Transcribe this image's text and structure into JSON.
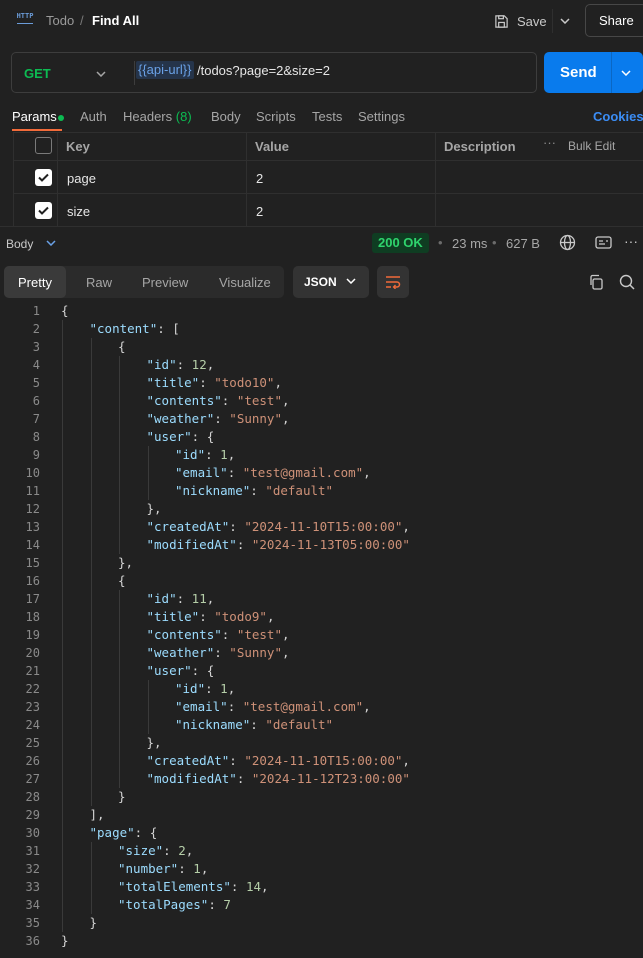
{
  "header": {
    "breadcrumb_parent": "Todo",
    "breadcrumb_sep": "/",
    "title": "Find All",
    "save_label": "Save",
    "share_label": "Share"
  },
  "request": {
    "method": "GET",
    "url_variable": "{{api-url}}",
    "url_path": "/todos?page=2&size=2",
    "send_label": "Send"
  },
  "tabs": {
    "params": "Params",
    "auth": "Auth",
    "headers": "Headers",
    "headers_count": "(8)",
    "body": "Body",
    "scripts": "Scripts",
    "tests": "Tests",
    "settings": "Settings",
    "cookies": "Cookies"
  },
  "params_table": {
    "headers": [
      "Key",
      "Value",
      "Description"
    ],
    "bulk_edit": "Bulk Edit",
    "rows": [
      {
        "key": "page",
        "value": "2",
        "checked": true
      },
      {
        "key": "size",
        "value": "2",
        "checked": true
      }
    ]
  },
  "response": {
    "section_label": "Body",
    "status": "200 OK",
    "time": "23 ms",
    "size": "627 B",
    "view_tabs": [
      "Pretty",
      "Raw",
      "Preview",
      "Visualize"
    ],
    "active_view": "Pretty",
    "format": "JSON"
  },
  "code_lines": [
    {
      "n": "1",
      "indent": 0,
      "parts": [
        [
          "p",
          "{"
        ]
      ]
    },
    {
      "n": "2",
      "indent": 1,
      "parts": [
        [
          "k",
          "\"content\""
        ],
        [
          "p",
          ": ["
        ]
      ]
    },
    {
      "n": "3",
      "indent": 2,
      "parts": [
        [
          "p",
          "{"
        ]
      ]
    },
    {
      "n": "4",
      "indent": 3,
      "parts": [
        [
          "k",
          "\"id\""
        ],
        [
          "p",
          ": "
        ],
        [
          "n",
          "12"
        ],
        [
          "p",
          ","
        ]
      ]
    },
    {
      "n": "5",
      "indent": 3,
      "parts": [
        [
          "k",
          "\"title\""
        ],
        [
          "p",
          ": "
        ],
        [
          "s",
          "\"todo10\""
        ],
        [
          "p",
          ","
        ]
      ]
    },
    {
      "n": "6",
      "indent": 3,
      "parts": [
        [
          "k",
          "\"contents\""
        ],
        [
          "p",
          ": "
        ],
        [
          "s",
          "\"test\""
        ],
        [
          "p",
          ","
        ]
      ]
    },
    {
      "n": "7",
      "indent": 3,
      "parts": [
        [
          "k",
          "\"weather\""
        ],
        [
          "p",
          ": "
        ],
        [
          "s",
          "\"Sunny\""
        ],
        [
          "p",
          ","
        ]
      ]
    },
    {
      "n": "8",
      "indent": 3,
      "parts": [
        [
          "k",
          "\"user\""
        ],
        [
          "p",
          ": {"
        ]
      ]
    },
    {
      "n": "9",
      "indent": 4,
      "parts": [
        [
          "k",
          "\"id\""
        ],
        [
          "p",
          ": "
        ],
        [
          "n",
          "1"
        ],
        [
          "p",
          ","
        ]
      ]
    },
    {
      "n": "10",
      "indent": 4,
      "parts": [
        [
          "k",
          "\"email\""
        ],
        [
          "p",
          ": "
        ],
        [
          "s",
          "\"test@gmail.com\""
        ],
        [
          "p",
          ","
        ]
      ]
    },
    {
      "n": "11",
      "indent": 4,
      "parts": [
        [
          "k",
          "\"nickname\""
        ],
        [
          "p",
          ": "
        ],
        [
          "s",
          "\"default\""
        ]
      ]
    },
    {
      "n": "12",
      "indent": 3,
      "parts": [
        [
          "p",
          "},"
        ]
      ]
    },
    {
      "n": "13",
      "indent": 3,
      "parts": [
        [
          "k",
          "\"createdAt\""
        ],
        [
          "p",
          ": "
        ],
        [
          "s",
          "\"2024-11-10T15:00:00\""
        ],
        [
          "p",
          ","
        ]
      ]
    },
    {
      "n": "14",
      "indent": 3,
      "parts": [
        [
          "k",
          "\"modifiedAt\""
        ],
        [
          "p",
          ": "
        ],
        [
          "s",
          "\"2024-11-13T05:00:00\""
        ]
      ]
    },
    {
      "n": "15",
      "indent": 2,
      "parts": [
        [
          "p",
          "},"
        ]
      ]
    },
    {
      "n": "16",
      "indent": 2,
      "parts": [
        [
          "p",
          "{"
        ]
      ]
    },
    {
      "n": "17",
      "indent": 3,
      "parts": [
        [
          "k",
          "\"id\""
        ],
        [
          "p",
          ": "
        ],
        [
          "n",
          "11"
        ],
        [
          "p",
          ","
        ]
      ]
    },
    {
      "n": "18",
      "indent": 3,
      "parts": [
        [
          "k",
          "\"title\""
        ],
        [
          "p",
          ": "
        ],
        [
          "s",
          "\"todo9\""
        ],
        [
          "p",
          ","
        ]
      ]
    },
    {
      "n": "19",
      "indent": 3,
      "parts": [
        [
          "k",
          "\"contents\""
        ],
        [
          "p",
          ": "
        ],
        [
          "s",
          "\"test\""
        ],
        [
          "p",
          ","
        ]
      ]
    },
    {
      "n": "20",
      "indent": 3,
      "parts": [
        [
          "k",
          "\"weather\""
        ],
        [
          "p",
          ": "
        ],
        [
          "s",
          "\"Sunny\""
        ],
        [
          "p",
          ","
        ]
      ]
    },
    {
      "n": "21",
      "indent": 3,
      "parts": [
        [
          "k",
          "\"user\""
        ],
        [
          "p",
          ": {"
        ]
      ]
    },
    {
      "n": "22",
      "indent": 4,
      "parts": [
        [
          "k",
          "\"id\""
        ],
        [
          "p",
          ": "
        ],
        [
          "n",
          "1"
        ],
        [
          "p",
          ","
        ]
      ]
    },
    {
      "n": "23",
      "indent": 4,
      "parts": [
        [
          "k",
          "\"email\""
        ],
        [
          "p",
          ": "
        ],
        [
          "s",
          "\"test@gmail.com\""
        ],
        [
          "p",
          ","
        ]
      ]
    },
    {
      "n": "24",
      "indent": 4,
      "parts": [
        [
          "k",
          "\"nickname\""
        ],
        [
          "p",
          ": "
        ],
        [
          "s",
          "\"default\""
        ]
      ]
    },
    {
      "n": "25",
      "indent": 3,
      "parts": [
        [
          "p",
          "},"
        ]
      ]
    },
    {
      "n": "26",
      "indent": 3,
      "parts": [
        [
          "k",
          "\"createdAt\""
        ],
        [
          "p",
          ": "
        ],
        [
          "s",
          "\"2024-11-10T15:00:00\""
        ],
        [
          "p",
          ","
        ]
      ]
    },
    {
      "n": "27",
      "indent": 3,
      "parts": [
        [
          "k",
          "\"modifiedAt\""
        ],
        [
          "p",
          ": "
        ],
        [
          "s",
          "\"2024-11-12T23:00:00\""
        ]
      ]
    },
    {
      "n": "28",
      "indent": 2,
      "parts": [
        [
          "p",
          "}"
        ]
      ]
    },
    {
      "n": "29",
      "indent": 1,
      "parts": [
        [
          "p",
          "],"
        ]
      ]
    },
    {
      "n": "30",
      "indent": 1,
      "parts": [
        [
          "k",
          "\"page\""
        ],
        [
          "p",
          ": {"
        ]
      ]
    },
    {
      "n": "31",
      "indent": 2,
      "parts": [
        [
          "k",
          "\"size\""
        ],
        [
          "p",
          ": "
        ],
        [
          "n",
          "2"
        ],
        [
          "p",
          ","
        ]
      ]
    },
    {
      "n": "32",
      "indent": 2,
      "parts": [
        [
          "k",
          "\"number\""
        ],
        [
          "p",
          ": "
        ],
        [
          "n",
          "1"
        ],
        [
          "p",
          ","
        ]
      ]
    },
    {
      "n": "33",
      "indent": 2,
      "parts": [
        [
          "k",
          "\"totalElements\""
        ],
        [
          "p",
          ": "
        ],
        [
          "n",
          "14"
        ],
        [
          "p",
          ","
        ]
      ]
    },
    {
      "n": "34",
      "indent": 2,
      "parts": [
        [
          "k",
          "\"totalPages\""
        ],
        [
          "p",
          ": "
        ],
        [
          "n",
          "7"
        ]
      ]
    },
    {
      "n": "35",
      "indent": 1,
      "parts": [
        [
          "p",
          "}"
        ]
      ]
    },
    {
      "n": "36",
      "indent": 0,
      "parts": [
        [
          "p",
          "}"
        ]
      ]
    }
  ]
}
